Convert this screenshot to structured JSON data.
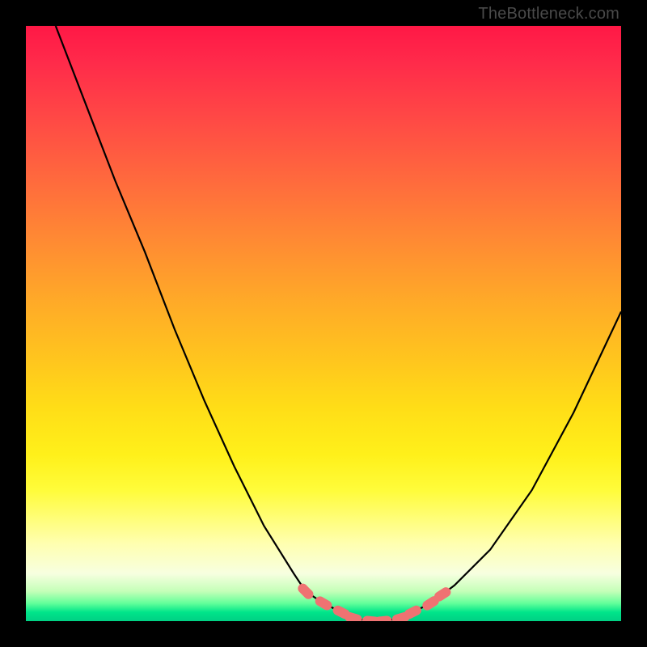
{
  "attribution": "TheBottleneck.com",
  "colors": {
    "frame": "#000000",
    "curve": "#000000",
    "marker": "#ef7272"
  },
  "chart_data": {
    "type": "line",
    "title": "",
    "xlabel": "",
    "ylabel": "",
    "xlim": [
      0,
      100
    ],
    "ylim": [
      0,
      100
    ],
    "grid": false,
    "legend": false,
    "note": "Axes are normalized 0–100 in both directions (no tick labels shown). y=0 is the bottom green band (optimal / no bottleneck), y=100 is the top red edge (maximum bottleneck). The curve is a V / well shape with its minimum plateau around x≈55–63.",
    "series": [
      {
        "name": "bottleneck-curve",
        "x": [
          5,
          10,
          15,
          20,
          25,
          30,
          35,
          40,
          45,
          47,
          50,
          53,
          55,
          58,
          60,
          63,
          65,
          68,
          72,
          78,
          85,
          92,
          100
        ],
        "y": [
          100,
          87,
          74,
          62,
          49,
          37,
          26,
          16,
          8,
          5,
          3,
          1.5,
          0.5,
          0,
          0,
          0.5,
          1.5,
          3,
          6,
          12,
          22,
          35,
          52
        ]
      }
    ],
    "markers": {
      "name": "highlighted-points",
      "note": "Salmon lozenge markers clustered near the curve minimum on both flanks and along the flat bottom.",
      "points": [
        {
          "x": 47,
          "y": 5
        },
        {
          "x": 50,
          "y": 3
        },
        {
          "x": 53,
          "y": 1.5
        },
        {
          "x": 55,
          "y": 0.5
        },
        {
          "x": 58,
          "y": 0
        },
        {
          "x": 60,
          "y": 0
        },
        {
          "x": 63,
          "y": 0.5
        },
        {
          "x": 65,
          "y": 1.5
        },
        {
          "x": 68,
          "y": 3
        },
        {
          "x": 70,
          "y": 4.5
        }
      ]
    }
  }
}
